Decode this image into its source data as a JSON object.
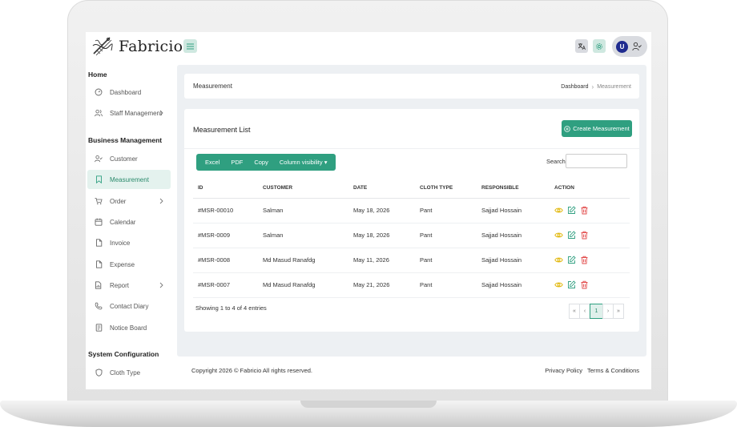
{
  "app": {
    "brand": "Fabricio",
    "avatar_initial": "U"
  },
  "sidebar": {
    "sections": [
      {
        "title": "Home",
        "items": [
          {
            "label": "Dashboard",
            "icon": "dashboard-icon"
          },
          {
            "label": "Staff Management",
            "icon": "users-icon",
            "has_submenu": true
          }
        ]
      },
      {
        "title": "Business Management",
        "items": [
          {
            "label": "Customer",
            "icon": "user-check-icon"
          },
          {
            "label": "Measurement",
            "icon": "bookmark-icon",
            "active": true
          },
          {
            "label": "Order",
            "icon": "cart-icon",
            "has_submenu": true
          },
          {
            "label": "Calendar",
            "icon": "calendar-icon"
          },
          {
            "label": "Invoice",
            "icon": "file-icon"
          },
          {
            "label": "Expense",
            "icon": "file-icon"
          },
          {
            "label": "Report",
            "icon": "report-icon",
            "has_submenu": true
          },
          {
            "label": "Contact Diary",
            "icon": "phone-icon"
          },
          {
            "label": "Notice Board",
            "icon": "board-icon"
          }
        ]
      },
      {
        "title": "System Configuration",
        "items": [
          {
            "label": "Cloth Type",
            "icon": "shield-icon"
          }
        ]
      }
    ]
  },
  "page_header": {
    "title": "Measurement",
    "breadcrumb": {
      "home": "Dashboard",
      "separator": "›",
      "current": "Measurement"
    }
  },
  "list": {
    "title": "Measurement List",
    "create_label": "Create Measurement",
    "export_buttons": [
      "Excel",
      "PDF",
      "Copy",
      "Column visibility ▾"
    ],
    "search_label": "Search:",
    "search_value": "",
    "columns": [
      "ID",
      "CUSTOMER",
      "DATE",
      "CLOTH TYPE",
      "RESPONSIBLE",
      "ACTION"
    ],
    "rows": [
      {
        "id": "#MSR-00010",
        "customer": "Salman",
        "date": "May 18, 2026",
        "cloth_type": "Pant",
        "responsible": "Sajjad Hossain"
      },
      {
        "id": "#MSR-0009",
        "customer": "Salman",
        "date": "May 18, 2026",
        "cloth_type": "Pant",
        "responsible": "Sajjad Hossain"
      },
      {
        "id": "#MSR-0008",
        "customer": "Md Masud Ranafdg",
        "date": "May 11, 2026",
        "cloth_type": "Pant",
        "responsible": "Sajjad Hossain"
      },
      {
        "id": "#MSR-0007",
        "customer": "Md Masud Ranafdg",
        "date": "May 21, 2026",
        "cloth_type": "Pant",
        "responsible": "Sajjad Hossain"
      }
    ],
    "showing_text": "Showing 1 to 4 of 4 entries",
    "pagination": {
      "first": "«",
      "prev": "‹",
      "current": "1",
      "next": "›",
      "last": "»"
    }
  },
  "footer": {
    "copyright": "Copyright 2026 © Fabricio All rights reserved.",
    "links": [
      "Privacy Policy",
      "Terms & Conditions"
    ]
  },
  "colors": {
    "accent": "#2f9f80",
    "accent_light": "#e4f2ee",
    "view": "#e0b400",
    "edit": "#2f9f80",
    "delete": "#e24b4b",
    "content_bg": "#edf0f3"
  }
}
